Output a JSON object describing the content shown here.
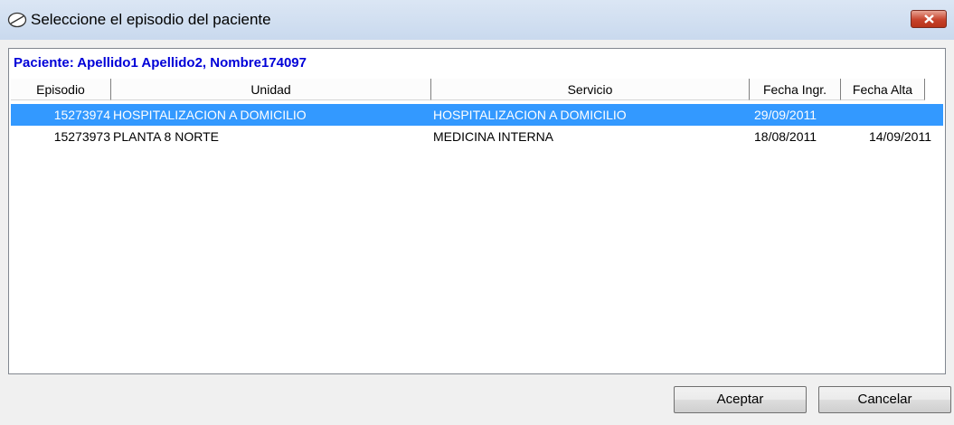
{
  "window": {
    "title": "Seleccione el episodio del paciente",
    "icon": "pill-icon",
    "close_icon": "close-icon"
  },
  "patient_label": "Paciente: Apellido1 Apellido2, Nombre174097",
  "table": {
    "columns": [
      "Episodio",
      "Unidad",
      "Servicio",
      "Fecha Ingr.",
      "Fecha Alta"
    ],
    "rows": [
      {
        "episodio": "15273974",
        "unidad": "HOSPITALIZACION A DOMICILIO",
        "servicio": "HOSPITALIZACION A DOMICILIO",
        "fecha_ingr": "29/09/2011",
        "fecha_alta": "",
        "selected": true
      },
      {
        "episodio": "15273973",
        "unidad": "PLANTA 8 NORTE",
        "servicio": "MEDICINA INTERNA",
        "fecha_ingr": "18/08/2011",
        "fecha_alta": "14/09/2011",
        "selected": false
      }
    ]
  },
  "buttons": {
    "accept": "Aceptar",
    "cancel": "Cancelar"
  },
  "colors": {
    "selection": "#3399ff",
    "patient_text": "#0000d8"
  }
}
